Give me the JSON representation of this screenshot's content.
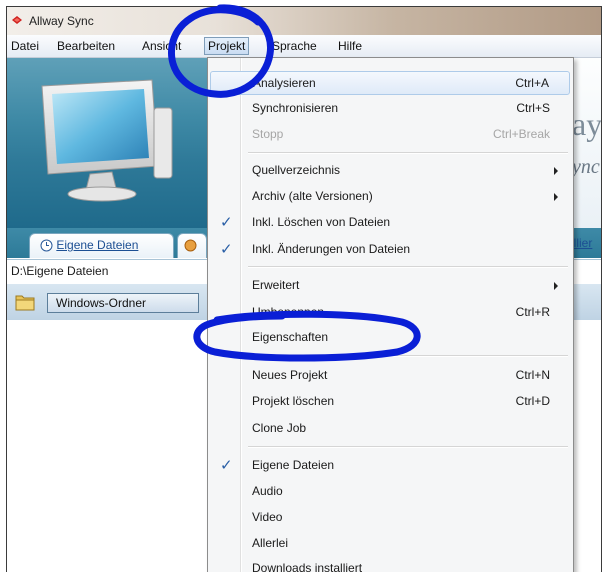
{
  "window": {
    "title": "Allway Sync"
  },
  "menubar": {
    "items": [
      {
        "label": "Datei"
      },
      {
        "label": "Bearbeiten"
      },
      {
        "label": "Ansicht"
      },
      {
        "label": "Projekt"
      },
      {
        "label": "Sprache"
      },
      {
        "label": "Hilfe"
      }
    ]
  },
  "banner": {
    "text1": "ay",
    "text2": "ync"
  },
  "tabs": {
    "active": "Eigene Dateien",
    "right_fragment": "allier"
  },
  "path": {
    "value": "D:\\Eigene Dateien"
  },
  "folder": {
    "button_label": "Windows-Ordner"
  },
  "dropdown": {
    "items": [
      {
        "label": "Analysieren",
        "shortcut": "Ctrl+A"
      },
      {
        "label": "Synchronisieren",
        "shortcut": "Ctrl+S"
      },
      {
        "label": "Stopp",
        "shortcut": "Ctrl+Break"
      },
      {
        "label": "Quellverzeichnis"
      },
      {
        "label": "Archiv (alte Versionen)"
      },
      {
        "label": "Inkl. Löschen von Dateien"
      },
      {
        "label": "Inkl. Änderungen von Dateien"
      },
      {
        "label": "Erweitert"
      },
      {
        "label": "Umbenennen",
        "shortcut": "Ctrl+R"
      },
      {
        "label": "Eigenschaften"
      },
      {
        "label": "Neues Projekt",
        "shortcut": "Ctrl+N"
      },
      {
        "label": "Projekt löschen",
        "shortcut": "Ctrl+D"
      },
      {
        "label": "Clone Job"
      },
      {
        "label": "Eigene Dateien"
      },
      {
        "label": "Audio"
      },
      {
        "label": "Video"
      },
      {
        "label": "Allerlei"
      },
      {
        "label": "Downloads installiert"
      }
    ],
    "check_glyph": "✓"
  },
  "colors": {
    "banner": "#2f7a99",
    "annotation": "#0a1fd6",
    "highlight": "#dfeaf8"
  }
}
